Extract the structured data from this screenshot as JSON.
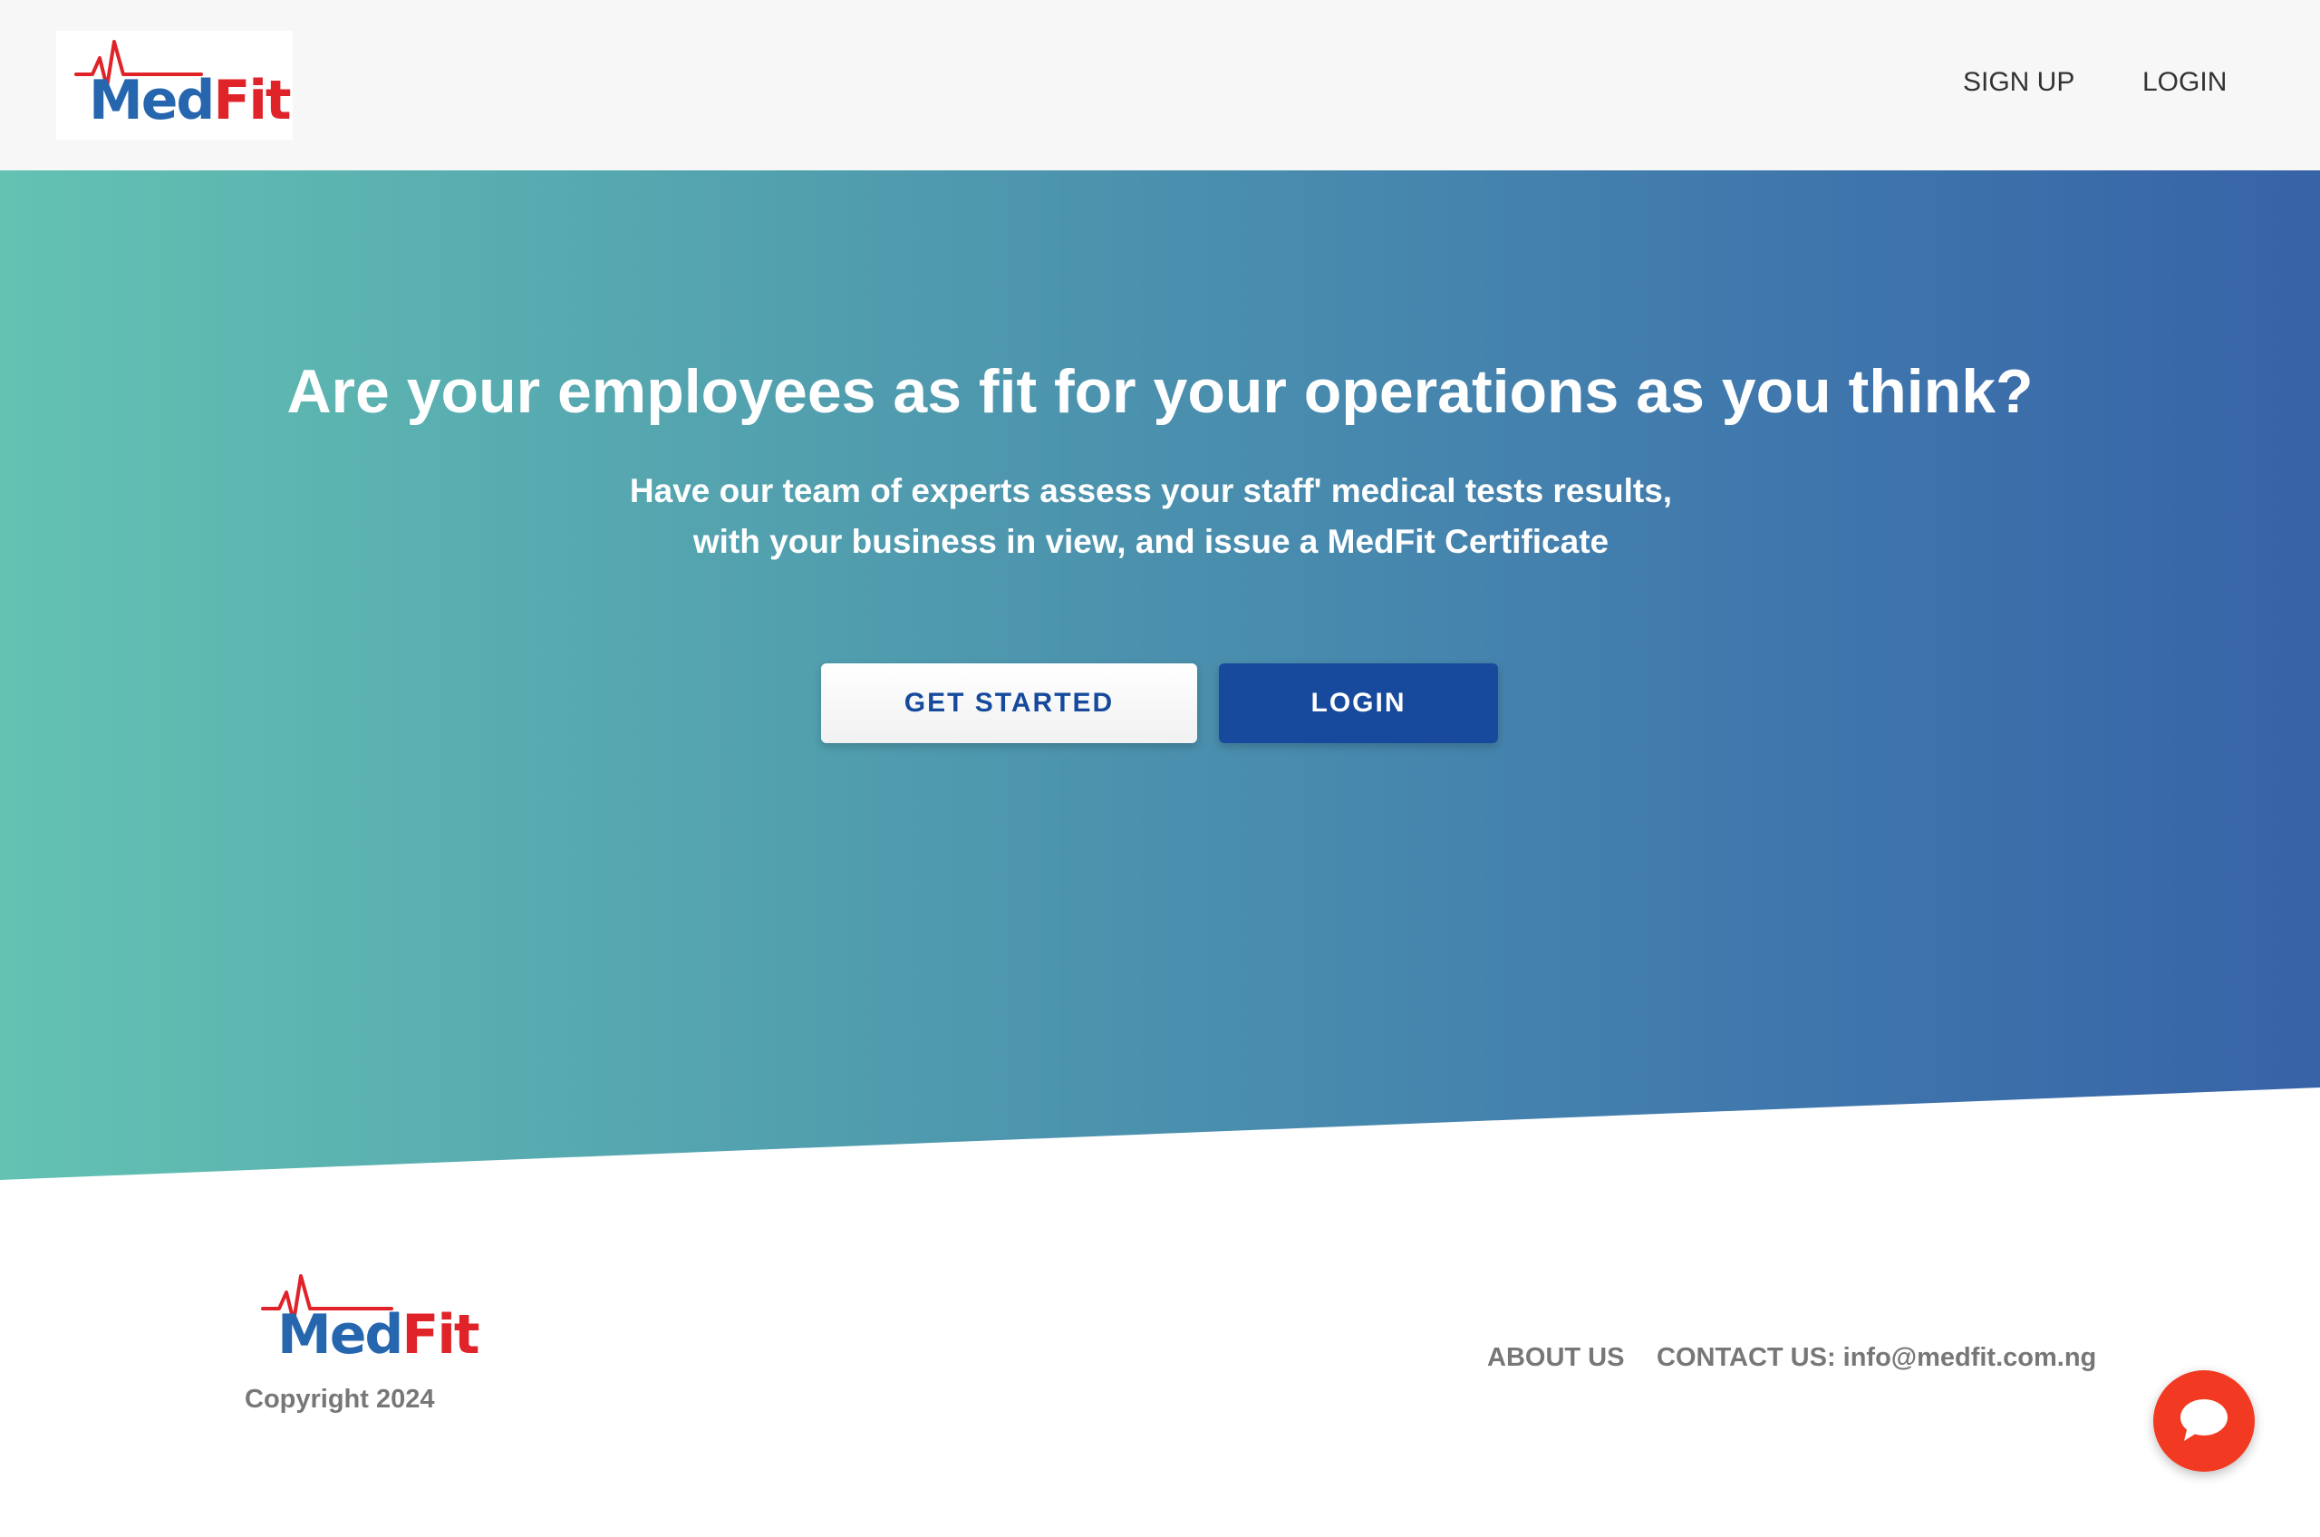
{
  "header": {
    "logo": {
      "text_med": "Med",
      "text_fit": "Fit"
    },
    "nav": [
      {
        "label": "SIGN UP"
      },
      {
        "label": "LOGIN"
      }
    ]
  },
  "hero": {
    "title": "Are your employees as fit for your operations as you think?",
    "subtitle_line1": "Have our team of experts assess your staff' medical tests results,",
    "subtitle_line2": "with your business in view, and issue a MedFit Certificate",
    "get_started_label": "GET STARTED",
    "login_label": "LOGIN"
  },
  "footer": {
    "logo": {
      "text_med": "Med",
      "text_fit": "Fit"
    },
    "copyright": "Copyright 2024",
    "about_label": "ABOUT US",
    "contact_label": "CONTACT US: info@medfit.com.ng"
  },
  "chat": {
    "icon": "chat-bubble-icon"
  },
  "colors": {
    "brand_blue": "#2666ae",
    "brand_red": "#e02328",
    "primary_button": "#174a9c",
    "gradient_start": "#63c2b2",
    "gradient_end": "#3763a7",
    "chat_button": "#f23a22",
    "footer_text": "#777777"
  }
}
